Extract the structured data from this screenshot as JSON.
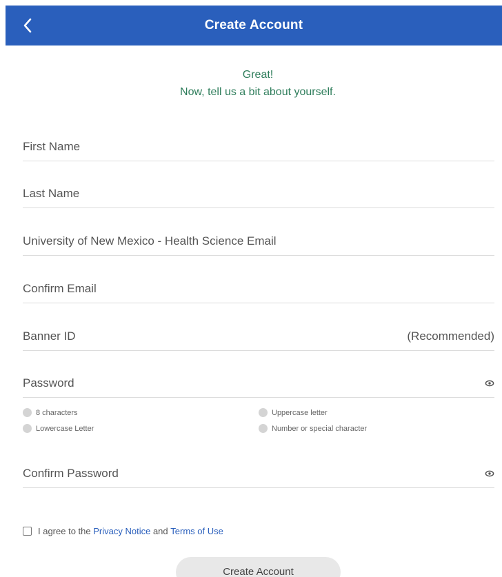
{
  "header": {
    "title": "Create Account"
  },
  "greeting": {
    "line1": "Great!",
    "line2": "Now, tell us a bit about yourself."
  },
  "form": {
    "first_name": {
      "placeholder": "First Name",
      "value": ""
    },
    "last_name": {
      "placeholder": "Last Name",
      "value": ""
    },
    "email": {
      "placeholder": "University of New Mexico - Health Science Email",
      "value": ""
    },
    "confirm_email": {
      "placeholder": "Confirm Email",
      "value": ""
    },
    "banner_id": {
      "placeholder": "Banner ID",
      "value": "",
      "suffix": "(Recommended)"
    },
    "password": {
      "placeholder": "Password",
      "value": ""
    },
    "confirm_password": {
      "placeholder": "Confirm Password",
      "value": ""
    }
  },
  "password_rules": [
    {
      "label": "8 characters"
    },
    {
      "label": "Uppercase letter"
    },
    {
      "label": "Lowercase Letter"
    },
    {
      "label": "Number or special character"
    }
  ],
  "agreement": {
    "prefix": "I agree to the",
    "privacy_link": "Privacy Notice",
    "conjunction": "and",
    "terms_link": "Terms of Use"
  },
  "submit": {
    "label": "Create Account"
  },
  "icons": {
    "back": "chevron-left-icon",
    "password_toggle": "eye-icon"
  },
  "colors": {
    "header_bg": "#2a5fbc",
    "greeting_text": "#2e7d5b",
    "link": "#2a5fbc",
    "rule_dot": "#d4d4d4",
    "button_bg": "#e8e8e8"
  }
}
